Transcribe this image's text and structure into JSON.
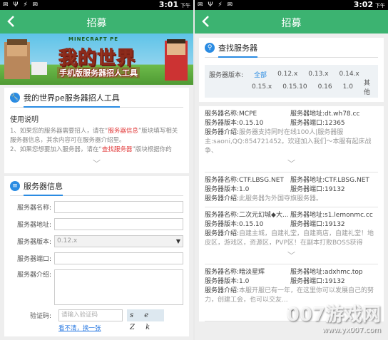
{
  "left": {
    "status": {
      "icons": "✉ Ψ ⚡ ✉",
      "time": "3:01",
      "ampm": "下午"
    },
    "appbar": {
      "title": "招募"
    },
    "banner": {
      "logo_top": "MINECRAFT PE",
      "logo": "我的世界",
      "subtitle": "手机版服务器招人工具"
    },
    "intro_card": {
      "title": "我的世界pe服务器招人工具",
      "usage_title": "使用说明",
      "line1_a": "1、如果您的服务器需要招人，请在“",
      "line1_hl": "服务器信息",
      "line1_b": "”版块填写相关服务器信息，其余内容可在服务器介绍里。",
      "line2_a": "2、如果您想要加入服务器，请在“",
      "line2_hl": "查找服务器",
      "line2_b": "”版块根据你的"
    },
    "form": {
      "title": "服务器信息",
      "name_label": "服务器名称:",
      "address_label": "服务器地址:",
      "version_label": "服务器版本:",
      "version_value": "0.12.x",
      "port_label": "服务器端口:",
      "intro_label": "服务器介绍:",
      "captcha_label": "验证码:",
      "captcha_placeholder": "请输入验证码",
      "captcha_text": "s e Z k",
      "refresh_link": "看不清，换一张"
    }
  },
  "right": {
    "status": {
      "icons": "✉ Ψ ⚡ ✉",
      "time": "3:02",
      "ampm": "下午"
    },
    "appbar": {
      "title": "招募"
    },
    "search": {
      "title": "查找服务器",
      "version_label": "服务器版本:",
      "options_row1": [
        "全部",
        "0.12.x",
        "0.13.x",
        "0.14.x"
      ],
      "options_row2": [
        "0.15.x",
        "0.15.10",
        "0.16",
        "1.0",
        "其他"
      ]
    },
    "servers": [
      {
        "name": "服务器名称:MCPE",
        "address": "服务器地址:dt.wh78.cc",
        "version": "服务器版本:0.15.10",
        "port": "服务器端口:12365",
        "intro_label": "服务器介绍:",
        "intro": "服务器支持同时在线100人|服务器服主:saoni,QQ:854721452。欢迎加入我们～本服有起床战争、"
      },
      {
        "name": "服务器名称:CTF.LBSG.NET",
        "address": "服务器地址:CTF.LBSG.NET",
        "version": "服务器版本:1.0",
        "port": "服务器端口:19132",
        "intro_label": "服务器介绍:",
        "intro": "此服务器为外国夺旗服务器。"
      },
      {
        "name": "服务器名称:二次元幻城◆大...",
        "address": "服务器地址:s1.lemonmc.cc",
        "version": "服务器版本:0.15.10",
        "port": "服务器端口:19132",
        "intro_label": "服务器介绍:",
        "intro": "自建主城，自建礼堂，自建商店，自建礼堂！地皮区，游戏区，资源区，PVP区！在副本打败BOSS获得"
      },
      {
        "name": "服务器名称:暗淡星辉",
        "address": "服务器地址:adxhmc.top",
        "version": "服务器版本:1.0",
        "port": "服务器端口:19132",
        "intro_label": "服务器介绍:",
        "intro": "本服开服已有一年，在这里你可以发展自己的努力，创建工会，也可以交友..."
      }
    ],
    "watermark": {
      "main": "007游戏网",
      "url": "www.yx007.com"
    }
  }
}
